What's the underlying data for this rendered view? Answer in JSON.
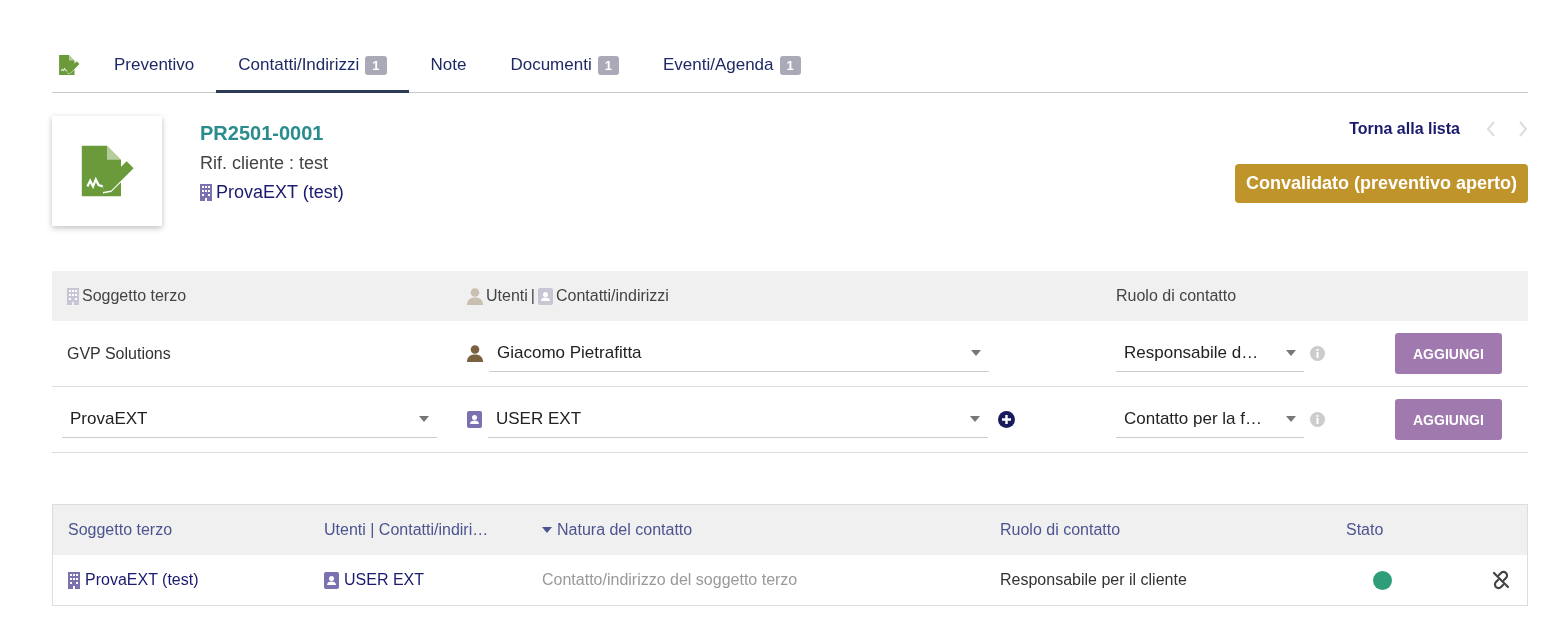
{
  "tabs": [
    {
      "label": "Preventivo",
      "selected": false
    },
    {
      "label": "Contatti/Indirizzi",
      "badge": "1",
      "selected": true
    },
    {
      "label": "Note",
      "selected": false
    },
    {
      "label": "Documenti",
      "badge": "1",
      "selected": false
    },
    {
      "label": "Eventi/Agenda",
      "badge": "1",
      "selected": false
    }
  ],
  "header": {
    "ref": "PR2501-0001",
    "ref_client": "Rif. cliente : test",
    "third_party": "ProvaEXT (test)",
    "back_link": "Torna alla lista",
    "status": "Convalidato (preventivo aperto)"
  },
  "form": {
    "header": {
      "third_party": "Soggetto terzo",
      "users": "Utenti",
      "separator": "|",
      "contacts": "Contatti/indirizzi",
      "role": "Ruolo di contatto"
    },
    "rows": [
      {
        "kind": "user",
        "third_party": "GVP Solutions",
        "contact": "Giacomo Pietrafitta",
        "can_create": false,
        "role": "Responsabile d…",
        "button": "AGGIUNGI"
      },
      {
        "kind": "contact",
        "third_party": "ProvaEXT",
        "contact": "USER EXT",
        "can_create": true,
        "role": "Contatto per la f…",
        "button": "AGGIUNGI"
      }
    ]
  },
  "list": {
    "columns": [
      {
        "label": "Soggetto terzo",
        "sorted": false
      },
      {
        "label": "Utenti | Contatti/indiri…",
        "sorted": false
      },
      {
        "label": "Natura del contatto",
        "sorted": true
      },
      {
        "label": "Ruolo di contatto",
        "sorted": false
      },
      {
        "label": "Stato",
        "sorted": false
      }
    ],
    "rows": [
      {
        "third_party": "ProvaEXT (test)",
        "contact": "USER EXT",
        "nature": "Contatto/indirizzo del soggetto terzo",
        "role": "Responsabile per il cliente",
        "active": true
      }
    ]
  }
}
